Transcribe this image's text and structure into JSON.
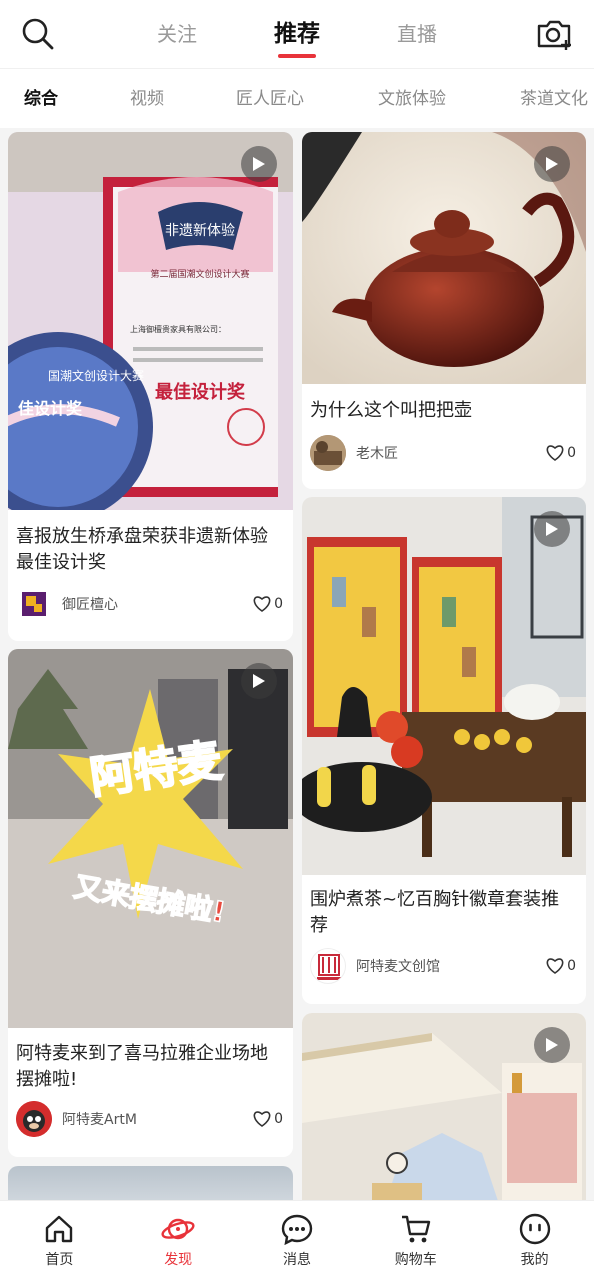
{
  "header": {
    "tabs": [
      {
        "label": "关注"
      },
      {
        "label": "推荐"
      },
      {
        "label": "直播"
      }
    ],
    "active_tab": "推荐",
    "accent_color": "#e8333a"
  },
  "categories": {
    "items": [
      "综合",
      "视频",
      "匠人匠心",
      "文旅体验",
      "茶道文化"
    ],
    "active": "综合"
  },
  "feed": {
    "left": [
      {
        "title": "喜报放生桥承盘荣获非遗新体验最佳设计奖",
        "author": "御匠檀心",
        "likes": "0",
        "image_text": {
          "fan_text": "非遗新体验",
          "event": "第二届国潮文创设计大赛",
          "company": "上海御檀贵家具有限公司：",
          "award": "最佳设计奖",
          "disc_ring": "国潮文创设计大赛",
          "disc_award": "佳设计奖"
        }
      },
      {
        "title": "阿特麦来到了喜马拉雅企业场地摆摊啦!",
        "author": "阿特麦ArtM",
        "likes": "0",
        "image_text": {
          "headline": "阿特麦",
          "subline": "又来摆摊啦!"
        }
      }
    ],
    "right": [
      {
        "title": "为什么这个叫把把壶",
        "author": "老木匠",
        "likes": "0"
      },
      {
        "title": "围炉煮茶~忆百胸针徽章套装推荐",
        "author": "阿特麦文创馆",
        "likes": "0"
      }
    ]
  },
  "bottom_nav": {
    "items": [
      {
        "label": "首页"
      },
      {
        "label": "发现"
      },
      {
        "label": "消息"
      },
      {
        "label": "购物车"
      },
      {
        "label": "我的"
      }
    ],
    "active": "发现"
  }
}
